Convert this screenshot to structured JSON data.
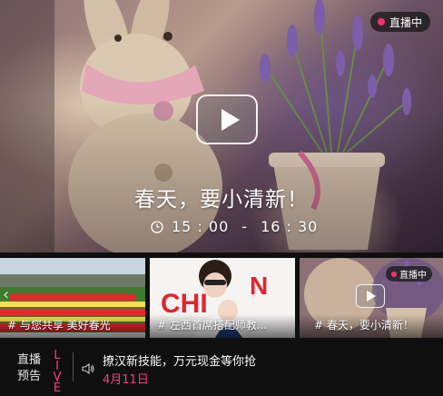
{
  "hero": {
    "badge": "直播中",
    "title": "春天，要小清新！",
    "time_start": "15 : 00",
    "time_sep": "-",
    "time_end": "16 : 30"
  },
  "thumbnails": [
    {
      "label": "# 与您共享 美好春光"
    },
    {
      "label": "# 左西首席搭配师教..."
    },
    {
      "label": "# 春天，要小清新！",
      "badge": "直播中"
    }
  ],
  "notice": {
    "label": "直播预告",
    "live": "LIVE",
    "title": "撩汉新技能，万元现金等你抢",
    "date": "4月11日"
  },
  "colors": {
    "accent": "#ff3b7f",
    "background": "#0f0f0f"
  }
}
